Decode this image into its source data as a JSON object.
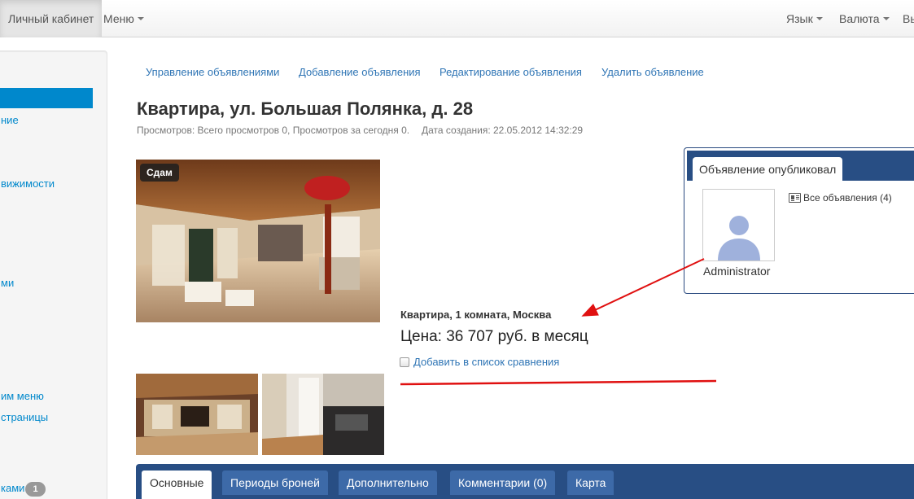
{
  "navbar": {
    "account": "Личный кабинет",
    "menu": "Меню",
    "language": "Язык",
    "currency": "Валюта",
    "exit_partial": "Вы"
  },
  "sidebar": {
    "items": [
      "ние",
      "вижимости",
      "ми",
      "им меню",
      "страницы",
      "ками"
    ],
    "badge": "1"
  },
  "subnav": {
    "manage": "Управление объявлениями",
    "add": "Добавление объявления",
    "edit": "Редактирование объявления",
    "delete": "Удалить объявление"
  },
  "listing": {
    "title": "Квартира, ул. Большая Полянка, д. 28",
    "views": "Просмотров: Всего просмотров 0, Просмотров за сегодня 0.",
    "created": "Дата создания: 22.05.2012 14:32:29",
    "badge": "Сдам",
    "type_line": "Квартира, 1 комната, Москва",
    "price": "Цена: 36 707 руб. в месяц",
    "compare": "Добавить в список сравнения"
  },
  "publisher": {
    "tab": "Объявление опубликовал",
    "name": "Administrator",
    "all_ads": "Все объявления (4)"
  },
  "tabs": [
    "Основные",
    "Периоды броней",
    "Дополнительно",
    "Комментарии (0)",
    "Карта"
  ],
  "colors": {
    "accent": "#0088cc",
    "link": "#2f75b5",
    "panel_blue": "#284e84",
    "annotation_red": "#e01010"
  }
}
